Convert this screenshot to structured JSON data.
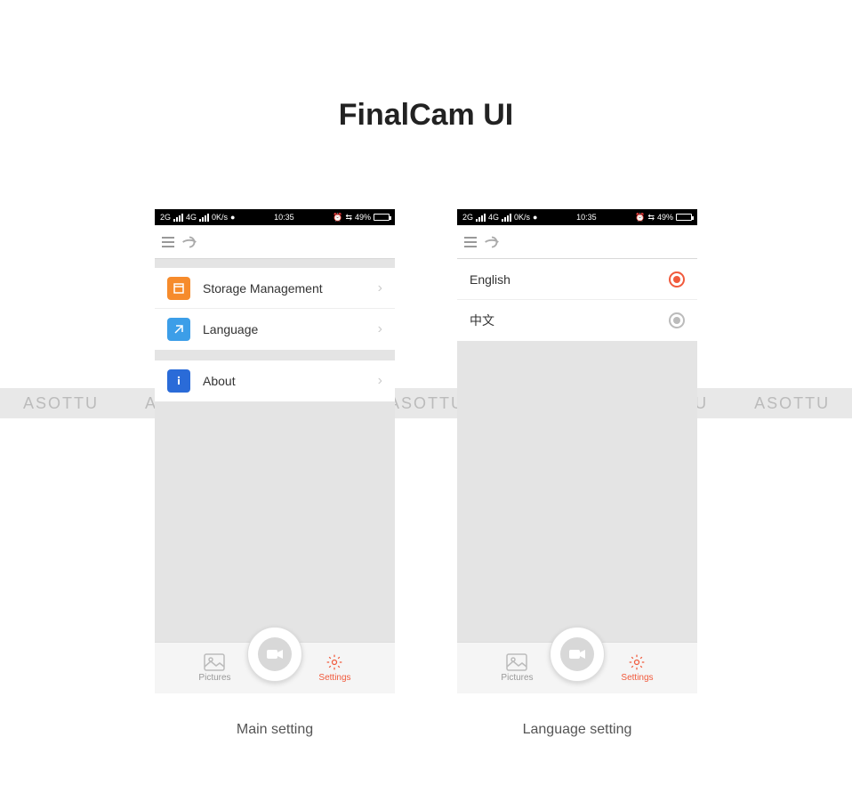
{
  "title": "FinalCam UI",
  "watermark": "ASOTTU",
  "statusbar": {
    "net1": "2G",
    "net2": "4G",
    "speed": "0K/s",
    "time": "10:35",
    "battery": "49%"
  },
  "screen1": {
    "caption": "Main setting",
    "items": [
      {
        "label": "Storage Management"
      },
      {
        "label": "Language"
      },
      {
        "label": "About"
      }
    ]
  },
  "screen2": {
    "caption": "Language setting",
    "items": [
      {
        "label": "English",
        "selected": true
      },
      {
        "label": "中文",
        "selected": false
      }
    ]
  },
  "tabs": {
    "pictures": "Pictures",
    "settings": "Settings"
  }
}
